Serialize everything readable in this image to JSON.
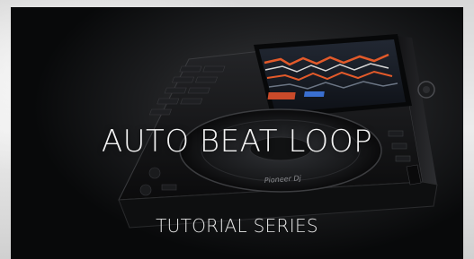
{
  "title": "AUTO BEAT LOOP",
  "subtitle": "TUTORIAL SERIES",
  "brand": "Pioneer Dj",
  "colors": {
    "background": "#0c0d0e",
    "screen_accent": "#e35a2a",
    "text": "#f4f4f4"
  },
  "icons": [
    "pioneer-dj-logo"
  ]
}
